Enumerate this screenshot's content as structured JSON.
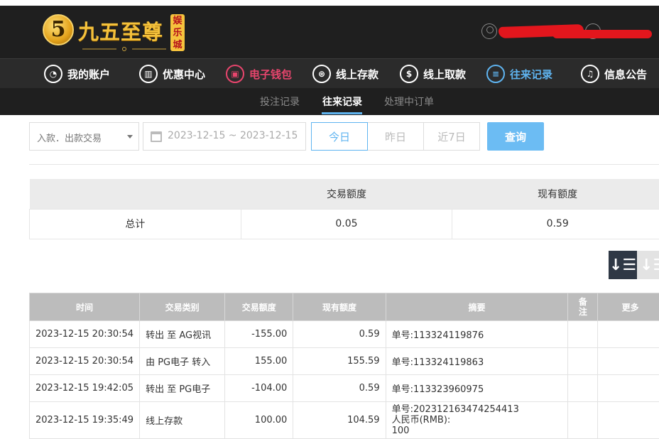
{
  "brand": {
    "coin_glyph": "5",
    "name": "九五至尊",
    "badge": [
      "娱",
      "乐",
      "城"
    ]
  },
  "colors": {
    "accent_blue": "#5fb4f0",
    "accent_red": "#e8456d",
    "header_bg": "#1f1f1f",
    "nav_bg": "#2b2b2b"
  },
  "nav": [
    {
      "label": "我的账户",
      "icon": "user-icon"
    },
    {
      "label": "优惠中心",
      "icon": "gift-icon"
    },
    {
      "label": "电子钱包",
      "icon": "wallet-icon"
    },
    {
      "label": "线上存款",
      "icon": "deposit-icon"
    },
    {
      "label": "线上取款",
      "icon": "withdraw-icon"
    },
    {
      "label": "往来记录",
      "icon": "records-icon"
    },
    {
      "label": "信息公告",
      "icon": "bell-icon"
    }
  ],
  "subnav": [
    "投注记录",
    "往来记录",
    "处理中订单"
  ],
  "filter": {
    "type_value": "入款．出款交易",
    "date_range": "2023-12-15 ~ 2023-12-15",
    "periods": [
      "今日",
      "昨日",
      "近7日"
    ],
    "query_label": "查询"
  },
  "summary": {
    "headers": [
      "",
      "交易额度",
      "现有额度"
    ],
    "row_label": "总计",
    "amount": "0.05",
    "balance": "0.59"
  },
  "sort": {
    "desc_glyph": "↓☰",
    "asc_glyph": "↓☰"
  },
  "table": {
    "headers": [
      "时间",
      "交易类别",
      "交易额度",
      "现有额度",
      "摘要",
      "备注",
      "更多"
    ],
    "rows": [
      {
        "time": "2023-12-15 20:30:54",
        "type": "转出 至 AG视讯",
        "amount": "-155.00",
        "balance": "0.59",
        "summary": "单号:113324119876"
      },
      {
        "time": "2023-12-15 20:30:54",
        "type": "由 PG电子 转入",
        "amount": "155.00",
        "balance": "155.59",
        "summary": "单号:113324119863"
      },
      {
        "time": "2023-12-15 19:42:05",
        "type": "转出 至 PG电子",
        "amount": "-104.00",
        "balance": "0.59",
        "summary": "单号:113323960975"
      },
      {
        "time": "2023-12-15 19:35:49",
        "type": "线上存款",
        "amount": "100.00",
        "balance": "104.59",
        "summary_lines": [
          "单号:202312163474254413",
          "人民币(RMB):",
          "100"
        ]
      }
    ]
  }
}
